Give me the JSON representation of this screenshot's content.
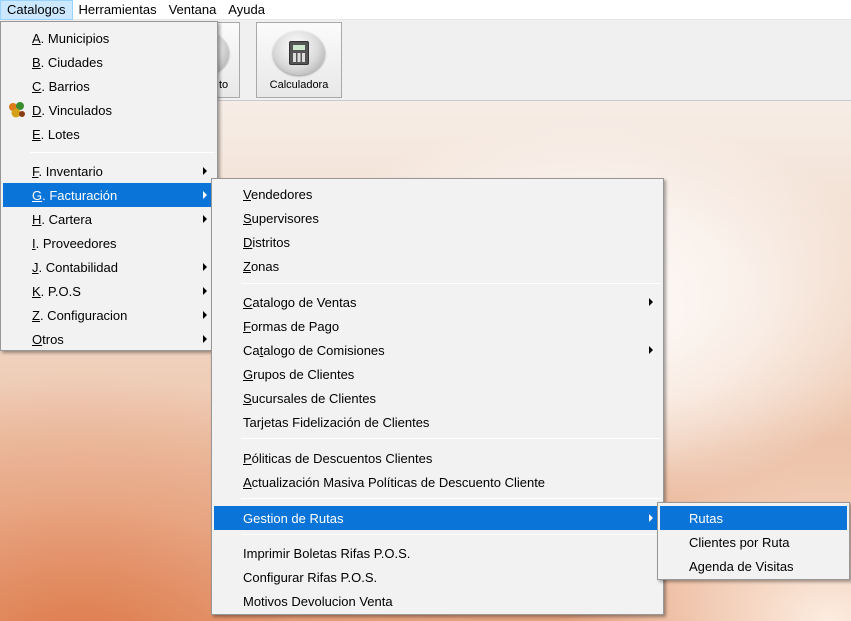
{
  "menubar": {
    "items": [
      {
        "label": "Catalogos",
        "active": true
      },
      {
        "label": "Herramientas",
        "active": false
      },
      {
        "label": "Ventana",
        "active": false
      },
      {
        "label": "Ayuda",
        "active": false
      }
    ]
  },
  "toolbar": {
    "partial_label": "to",
    "calculator_label": "Calculadora"
  },
  "catalogos_menu": {
    "items": [
      {
        "key": "A",
        "rest": ". Municipios"
      },
      {
        "key": "B",
        "rest": ". Ciudades"
      },
      {
        "key": "C",
        "rest": ". Barrios"
      },
      {
        "key": "D",
        "rest": ". Vinculados",
        "icon": "vinculados-icon"
      },
      {
        "key": "E",
        "rest": ". Lotes"
      },
      {
        "key": "F",
        "rest": ".  Inventario"
      },
      {
        "key": "G",
        "rest": ". Facturación"
      },
      {
        "key": "H",
        "rest": ". Cartera"
      },
      {
        "key": "I",
        "rest": ". Proveedores"
      },
      {
        "key": "J",
        "rest": ". Contabilidad"
      },
      {
        "key": "K",
        "rest": ". P.O.S"
      },
      {
        "key": "Z",
        "rest": ". Configuracion"
      },
      {
        "key": "O",
        "rest": "tros"
      }
    ]
  },
  "facturacion_menu": {
    "items": [
      {
        "key": "V",
        "rest": "endedores"
      },
      {
        "key": "S",
        "rest": "upervisores"
      },
      {
        "key": "D",
        "rest": "istritos"
      },
      {
        "key": "Z",
        "rest": "onas"
      },
      {
        "key": "C",
        "rest": "atalogo de Ventas"
      },
      {
        "key": "F",
        "rest": "ormas de Pago"
      },
      {
        "pre": "Ca",
        "key": "t",
        "rest": "alogo de Comisiones"
      },
      {
        "key": "G",
        "rest": "rupos de Clientes"
      },
      {
        "key": "S",
        "rest": "ucursales de Clientes"
      },
      {
        "label": "Tarjetas Fidelización de Clientes"
      },
      {
        "key": "P",
        "rest": "óliticas de Descuentos Clientes"
      },
      {
        "key": "A",
        "rest": "ctualización Masiva Políticas de Descuento Cliente"
      },
      {
        "label": "Gestion de  Rutas"
      },
      {
        "label": "Imprimir Boletas Rifas P.O.S."
      },
      {
        "label": "Configurar Rifas  P.O.S."
      },
      {
        "label": "Motivos Devolucion Venta"
      }
    ]
  },
  "rutas_menu": {
    "items": [
      {
        "label": "Rutas"
      },
      {
        "label": "Clientes por Ruta"
      },
      {
        "label": "Agenda de Visitas"
      }
    ]
  },
  "colors": {
    "highlight": "#0a74d8",
    "menu_background": "#f2f2f2"
  }
}
